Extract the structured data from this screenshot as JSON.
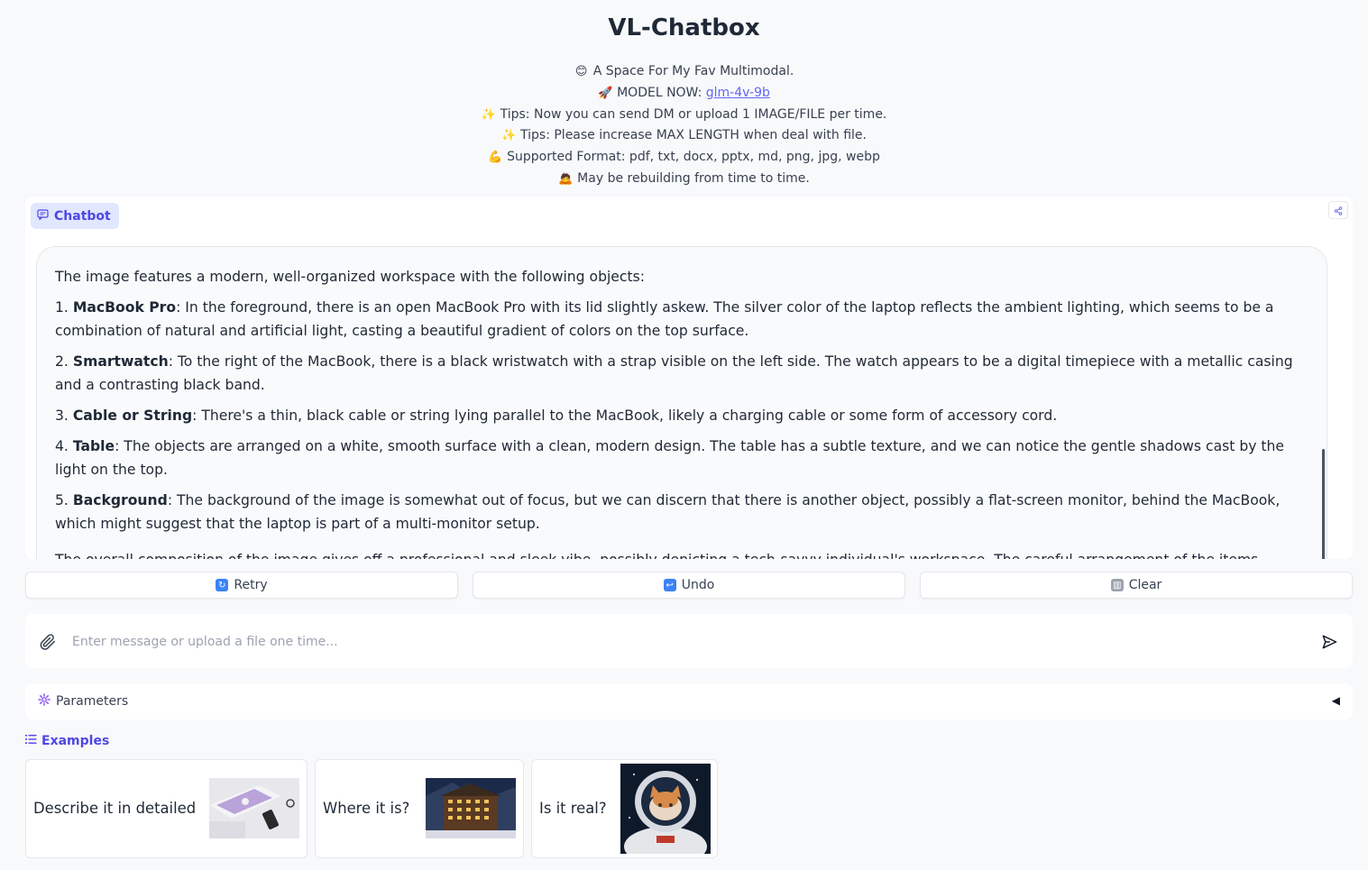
{
  "header": {
    "title": "VL-Chatbox",
    "lines": [
      {
        "emoji": "😊",
        "text": "A Space For My Fav Multimodal."
      },
      {
        "emoji": "🚀",
        "text": "MODEL NOW: "
      },
      {
        "emoji": "✨",
        "text": "Tips: Now you can send DM or upload 1 IMAGE/FILE per time."
      },
      {
        "emoji": "✨",
        "text": "Tips: Please increase MAX LENGTH when deal with file."
      },
      {
        "emoji": "💪",
        "text": "Supported Format: pdf, txt, docx, pptx, md, png, jpg, webp"
      },
      {
        "emoji": "🙇",
        "text": "May be rebuilding from time to time."
      }
    ],
    "model_link": "glm-4v-9b"
  },
  "chatbot": {
    "label": "Chatbot",
    "intro": "The image features a modern, well-organized workspace with the following objects:",
    "items": [
      {
        "num": "1. ",
        "name": "MacBook Pro",
        "text": ": In the foreground, there is an open MacBook Pro with its lid slightly askew. The silver color of the laptop reflects the ambient lighting, which seems to be a combination of natural and artificial light, casting a beautiful gradient of colors on the top surface."
      },
      {
        "num": "2. ",
        "name": "Smartwatch",
        "text": ": To the right of the MacBook, there is a black wristwatch with a strap visible on the left side. The watch appears to be a digital timepiece with a metallic casing and a contrasting black band."
      },
      {
        "num": "3. ",
        "name": "Cable or String",
        "text": ": There's a thin, black cable or string lying parallel to the MacBook, likely a charging cable or some form of accessory cord."
      },
      {
        "num": "4. ",
        "name": "Table",
        "text": ": The objects are arranged on a white, smooth surface with a clean, modern design. The table has a subtle texture, and we can notice the gentle shadows cast by the light on the top."
      },
      {
        "num": "5. ",
        "name": "Background",
        "text": ": The background of the image is somewhat out of focus, but we can discern that there is another object, possibly a flat-screen monitor, behind the MacBook, which might suggest that the laptop is part of a multi-monitor setup."
      }
    ],
    "outro": "The overall composition of the image gives off a professional and sleek vibe, possibly depicting a tech-savvy individual's workspace. The careful arrangement of the items"
  },
  "actions": {
    "retry": "Retry",
    "undo": "Undo",
    "clear": "Clear"
  },
  "input": {
    "placeholder": "Enter message or upload a file one time..."
  },
  "parameters": {
    "label": "Parameters"
  },
  "examples": {
    "label": "Examples",
    "items": [
      {
        "text": "Describe it in detailed"
      },
      {
        "text": "Where it is?"
      },
      {
        "text": "Is it real?"
      }
    ]
  },
  "colors": {
    "accent": "#4f46e5",
    "link": "#6366f1",
    "background": "#f8f9fb"
  }
}
